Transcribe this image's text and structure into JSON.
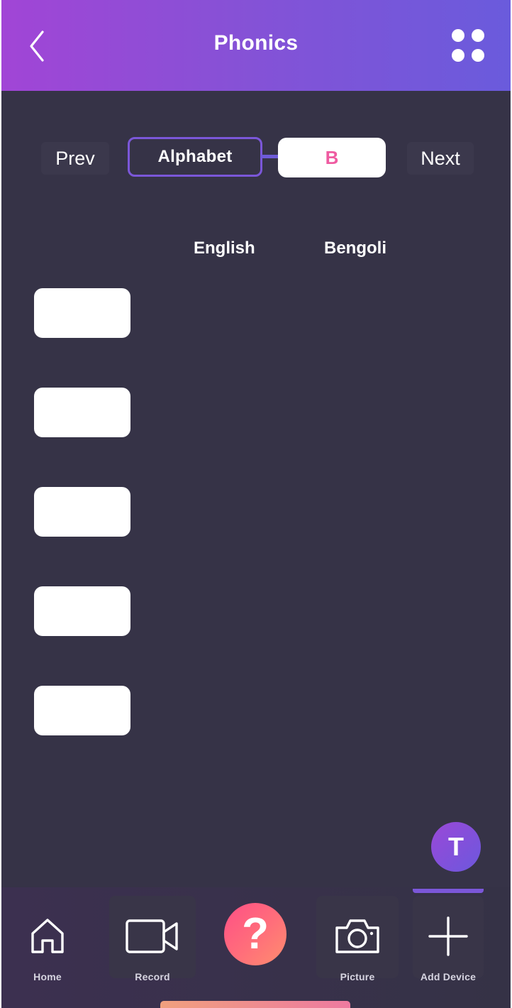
{
  "header": {
    "title": "Phonics",
    "back_icon": "chevron-left-icon",
    "menu_icon": "four-dots-icon",
    "gradient": [
      "#a145d6",
      "#6a5bdc"
    ]
  },
  "selector": {
    "prev_label": "Prev",
    "category_label": "Alphabet",
    "current_letter": "B",
    "next_label": "Next",
    "accent": "#7b57d9",
    "letter_color": "#ef5ba1"
  },
  "columns": {
    "english": "English",
    "bengali": "Bengoli"
  },
  "word_rows": [
    {
      "label": ""
    },
    {
      "label": ""
    },
    {
      "label": ""
    },
    {
      "label": ""
    },
    {
      "label": ""
    }
  ],
  "avatar": {
    "initial": "T"
  },
  "tabbar": {
    "home": {
      "label": "Home",
      "icon": "home-icon"
    },
    "record": {
      "label": "Record",
      "icon": "video-camera-icon"
    },
    "help": {
      "label": "?",
      "icon": "help-icon"
    },
    "picture": {
      "label": "Picture",
      "icon": "camera-icon"
    },
    "add_device": {
      "label": "Add Device",
      "icon": "plus-icon"
    }
  },
  "colors": {
    "background": "#363347",
    "help_button": "#ff5f7e"
  }
}
